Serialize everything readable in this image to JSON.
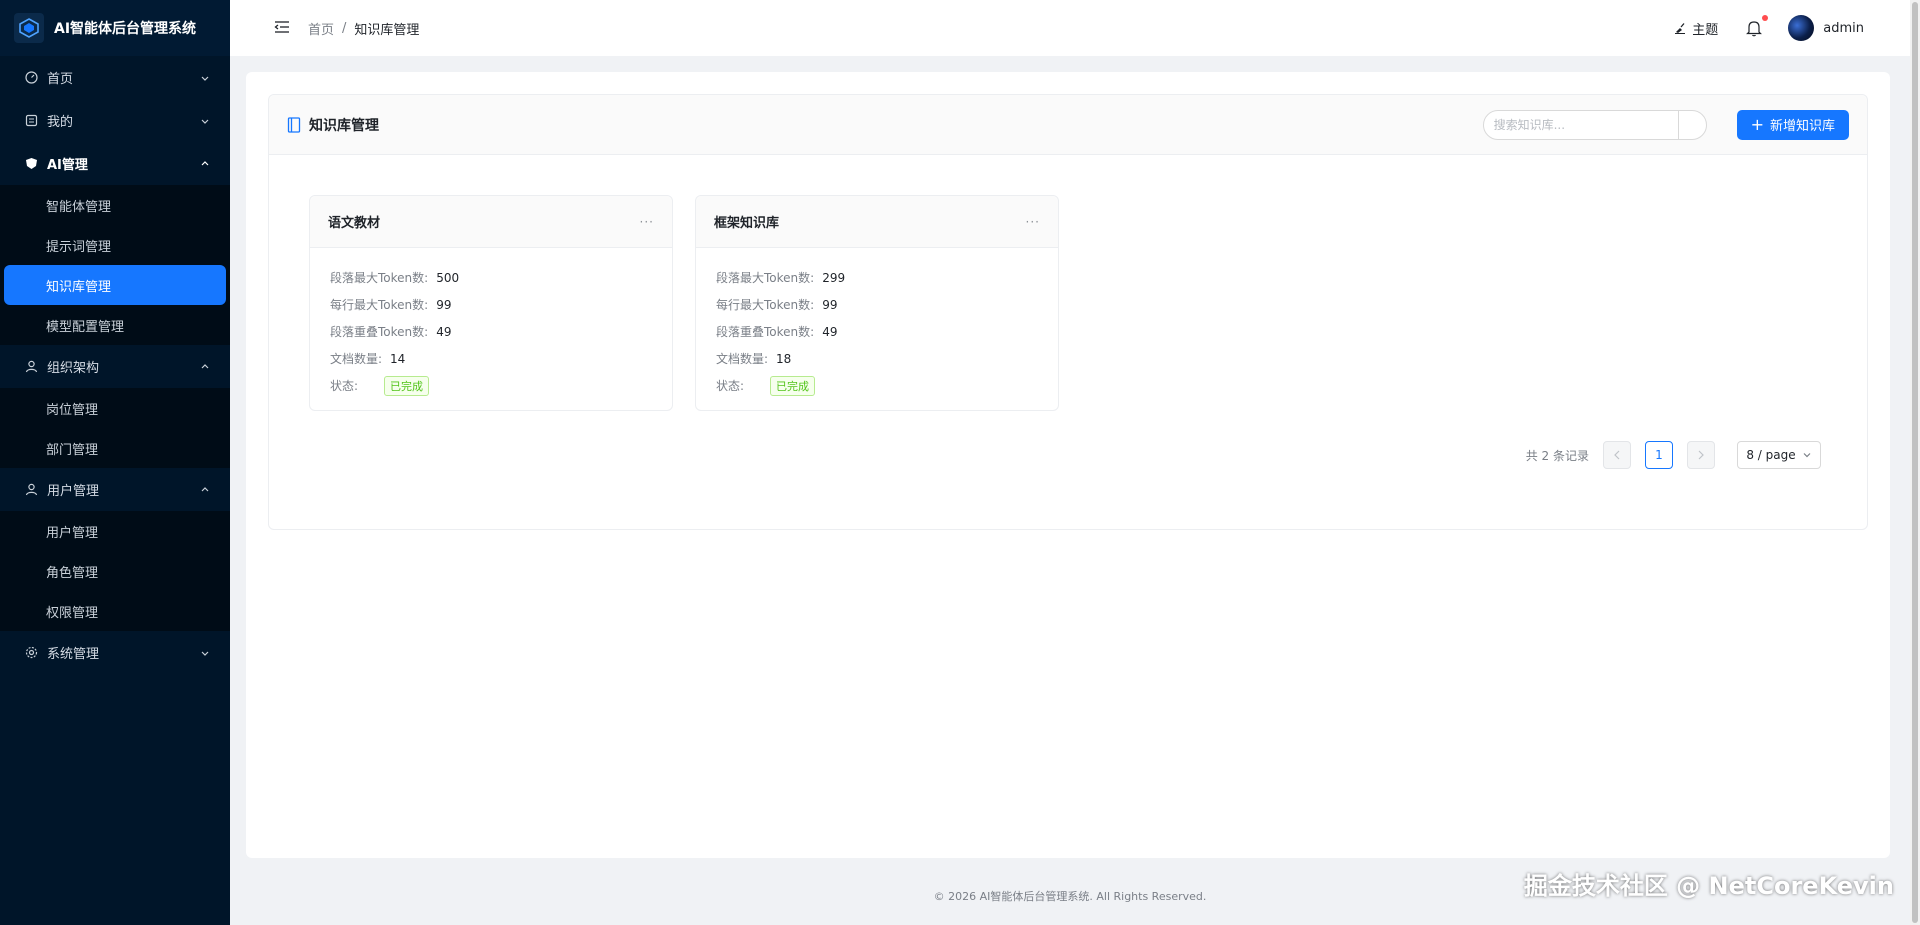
{
  "app": {
    "title": "AI智能体后台管理系统"
  },
  "sidebar": {
    "groups": [
      {
        "label": "首页",
        "icon": "dashboard-icon",
        "open": false
      },
      {
        "label": "我的",
        "icon": "profile-icon",
        "open": false
      },
      {
        "label": "AI管理",
        "icon": "ai-icon",
        "open": true,
        "items": [
          {
            "label": "智能体管理"
          },
          {
            "label": "提示词管理"
          },
          {
            "label": "知识库管理",
            "active": true
          },
          {
            "label": "模型配置管理"
          }
        ]
      },
      {
        "label": "组织架构",
        "icon": "org-icon",
        "open": true,
        "items": [
          {
            "label": "岗位管理"
          },
          {
            "label": "部门管理"
          }
        ]
      },
      {
        "label": "用户管理",
        "icon": "user-icon",
        "open": true,
        "items": [
          {
            "label": "用户管理"
          },
          {
            "label": "角色管理"
          },
          {
            "label": "权限管理"
          }
        ]
      },
      {
        "label": "系统管理",
        "icon": "settings-icon",
        "open": false
      }
    ]
  },
  "header": {
    "breadcrumb": {
      "home": "首页",
      "separator": "/",
      "current": "知识库管理"
    },
    "theme_label": "主题",
    "username": "admin"
  },
  "panel": {
    "title": "知识库管理",
    "search_placeholder": "搜索知识库...",
    "add_label": "新增知识库"
  },
  "knowledge_bases": [
    {
      "name": "语文教材",
      "more": "···",
      "fields": [
        {
          "key": "段落最大Token数:",
          "value": "500"
        },
        {
          "key": "每行最大Token数:",
          "value": "99"
        },
        {
          "key": "段落重叠Token数:",
          "value": "49"
        },
        {
          "key": "文档数量:",
          "value": "14"
        }
      ],
      "status_key": "状态:",
      "status": "已完成"
    },
    {
      "name": "框架知识库",
      "more": "···",
      "fields": [
        {
          "key": "段落最大Token数:",
          "value": "299"
        },
        {
          "key": "每行最大Token数:",
          "value": "99"
        },
        {
          "key": "段落重叠Token数:",
          "value": "49"
        },
        {
          "key": "文档数量:",
          "value": "18"
        }
      ],
      "status_key": "状态:",
      "status": "已完成"
    }
  ],
  "pagination": {
    "total_text": "共 2 条记录",
    "current_page": "1",
    "page_size": "8 / page"
  },
  "footer": {
    "text": "© 2026 AI智能体后台管理系统. All Rights Reserved."
  },
  "watermark": "掘金技术社区 @ NetCoreKevin",
  "colors": {
    "sidebar_bg": "#001529",
    "accent": "#1677ff",
    "success": "#52c41a"
  }
}
